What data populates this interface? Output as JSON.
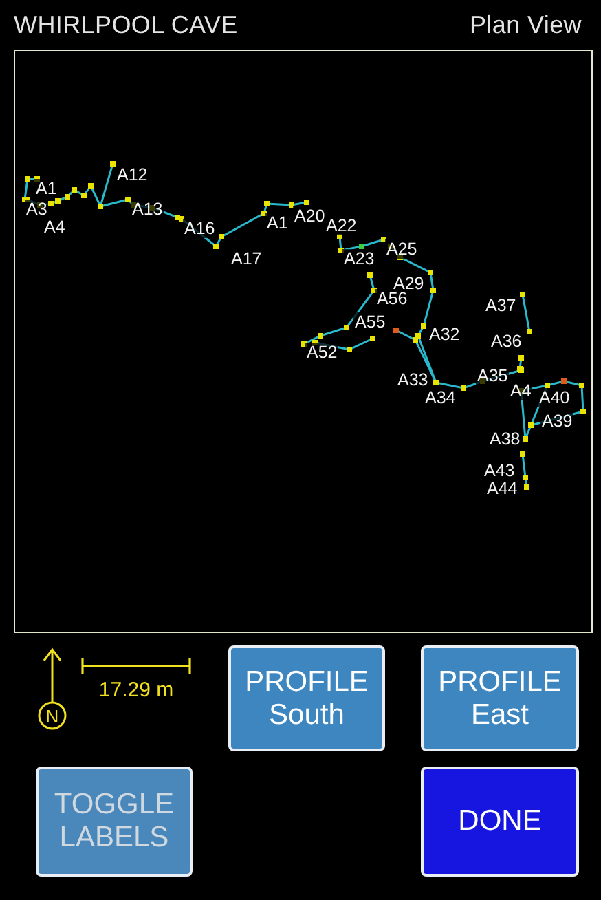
{
  "header": {
    "title": "WHIRLPOOL CAVE",
    "view": "Plan View"
  },
  "map": {
    "stations": [
      {
        "label": "A1"
      },
      {
        "label": "A12"
      },
      {
        "label": "A3"
      },
      {
        "label": "A4"
      },
      {
        "label": "A13"
      },
      {
        "label": "A16"
      },
      {
        "label": "A17"
      },
      {
        "label": "A1"
      },
      {
        "label": "A20"
      },
      {
        "label": "A22"
      },
      {
        "label": "A23"
      },
      {
        "label": "A25"
      },
      {
        "label": "A29"
      },
      {
        "label": "A56"
      },
      {
        "label": "A55"
      },
      {
        "label": "A32"
      },
      {
        "label": "A52"
      },
      {
        "label": "A33"
      },
      {
        "label": "A34"
      },
      {
        "label": "A37"
      },
      {
        "label": "A36"
      },
      {
        "label": "A35"
      },
      {
        "label": "A4"
      },
      {
        "label": "A40"
      },
      {
        "label": "A39"
      },
      {
        "label": "A38"
      },
      {
        "label": "A43"
      },
      {
        "label": "A44"
      }
    ]
  },
  "legend": {
    "north": "N",
    "scale": "17.29 m"
  },
  "buttons": [
    {
      "lines": [
        "PROFILE",
        "South"
      ],
      "kind": "normal"
    },
    {
      "lines": [
        "PROFILE",
        "East"
      ],
      "kind": "normal"
    },
    {
      "lines": [
        "TOGGLE",
        "LABELS"
      ],
      "kind": "toggle"
    },
    {
      "lines": [
        "DONE"
      ],
      "kind": "primary"
    }
  ]
}
